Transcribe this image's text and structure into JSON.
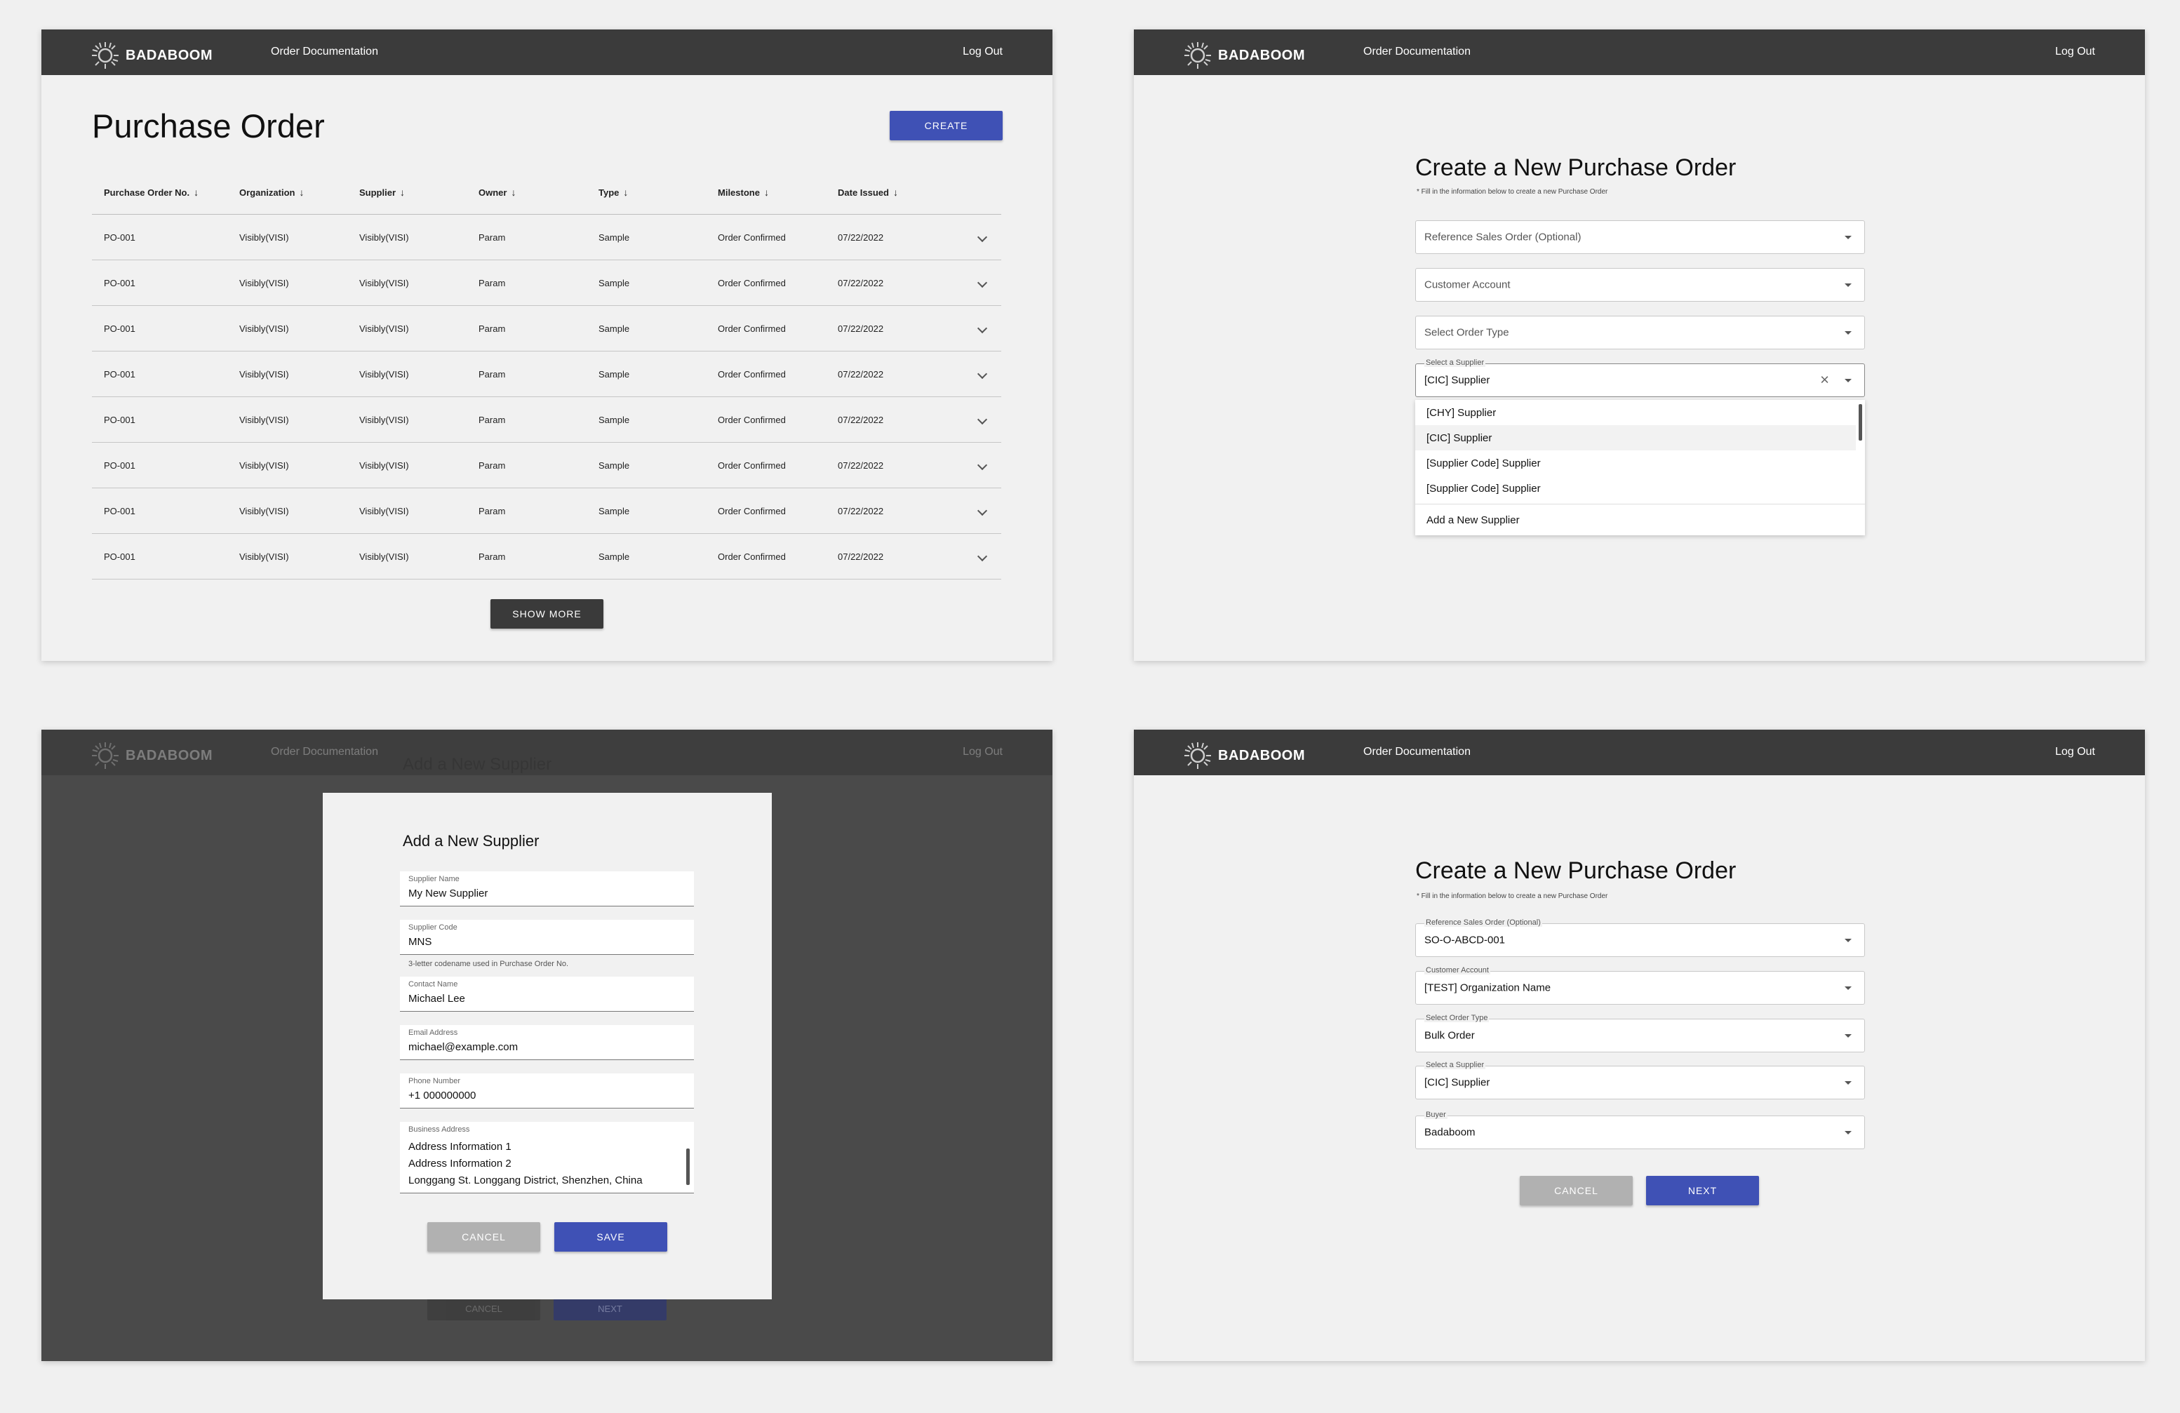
{
  "nav": {
    "brand": "BADABOOM",
    "link": "Order Documentation",
    "logout": "Log Out"
  },
  "colors": {
    "nav_bg": "#3b3b3b",
    "primary": "#3f51b5",
    "dark_button": "#3a3a3a",
    "disabled_button": "#b1b1b1",
    "overlay": "#4a4a4a"
  },
  "list": {
    "title": "Purchase Order",
    "create_label": "CREATE",
    "show_more_label": "SHOW MORE",
    "columns": [
      "Purchase Order No.",
      "Organization",
      "Supplier",
      "Owner",
      "Type",
      "Milestone",
      "Date Issued"
    ],
    "rows": [
      [
        "PO-001",
        "Visibly(VISI)",
        "Visibly(VISI)",
        "Param",
        "Sample",
        "Order Confirmed",
        "07/22/2022"
      ],
      [
        "PO-001",
        "Visibly(VISI)",
        "Visibly(VISI)",
        "Param",
        "Sample",
        "Order Confirmed",
        "07/22/2022"
      ],
      [
        "PO-001",
        "Visibly(VISI)",
        "Visibly(VISI)",
        "Param",
        "Sample",
        "Order Confirmed",
        "07/22/2022"
      ],
      [
        "PO-001",
        "Visibly(VISI)",
        "Visibly(VISI)",
        "Param",
        "Sample",
        "Order Confirmed",
        "07/22/2022"
      ],
      [
        "PO-001",
        "Visibly(VISI)",
        "Visibly(VISI)",
        "Param",
        "Sample",
        "Order Confirmed",
        "07/22/2022"
      ],
      [
        "PO-001",
        "Visibly(VISI)",
        "Visibly(VISI)",
        "Param",
        "Sample",
        "Order Confirmed",
        "07/22/2022"
      ],
      [
        "PO-001",
        "Visibly(VISI)",
        "Visibly(VISI)",
        "Param",
        "Sample",
        "Order Confirmed",
        "07/22/2022"
      ],
      [
        "PO-001",
        "Visibly(VISI)",
        "Visibly(VISI)",
        "Param",
        "Sample",
        "Order Confirmed",
        "07/22/2022"
      ]
    ]
  },
  "create_form": {
    "title": "Create a New Purchase Order",
    "subtitle": "* Fill in the information below to create a new Purchase Order",
    "ref_placeholder": "Reference Sales Order (Optional)",
    "customer_placeholder": "Customer Account",
    "order_type_placeholder": "Select Order Type",
    "supplier_label": "Select a Supplier",
    "supplier_value": "[CIC] Supplier",
    "dropdown_options": [
      "[CHY] Supplier",
      "[CIC] Supplier",
      "[Supplier Code] Supplier",
      "[Supplier Code] Supplier"
    ],
    "add_supplier_label": "Add a New Supplier"
  },
  "modal": {
    "title": "Add a New Supplier",
    "supplier_name_label": "Supplier Name",
    "supplier_name_value": "My New Supplier",
    "supplier_code_label": "Supplier Code",
    "supplier_code_value": "MNS",
    "supplier_code_helper": "3-letter codename used in Purchase Order No.",
    "contact_label": "Contact Name",
    "contact_value": "Michael Lee",
    "email_label": "Email Address",
    "email_value": "michael@example.com",
    "phone_label": "Phone Number",
    "phone_value": "+1 000000000",
    "address_label": "Business Address",
    "address_lines": [
      "Address Information 1",
      "Address Information 2",
      "Longgang St. Longgang District, Shenzhen, China"
    ],
    "cancel_label": "CANCEL",
    "save_label": "SAVE",
    "bg_cancel_label": "CANCEL",
    "bg_next_label": "NEXT"
  },
  "filled_form": {
    "title": "Create a New Purchase Order",
    "subtitle": "* Fill in the information below to create a new Purchase Order",
    "ref_label": "Reference Sales Order (Optional)",
    "ref_value": "SO-O-ABCD-001",
    "customer_label": "Customer Account",
    "customer_value": "[TEST] Organization Name",
    "order_type_label": "Select Order Type",
    "order_type_value": "Bulk Order",
    "supplier_label": "Select a Supplier",
    "supplier_value": "[CIC] Supplier",
    "buyer_label": "Buyer",
    "buyer_value": "Badaboom",
    "cancel_label": "CANCEL",
    "next_label": "NEXT"
  }
}
